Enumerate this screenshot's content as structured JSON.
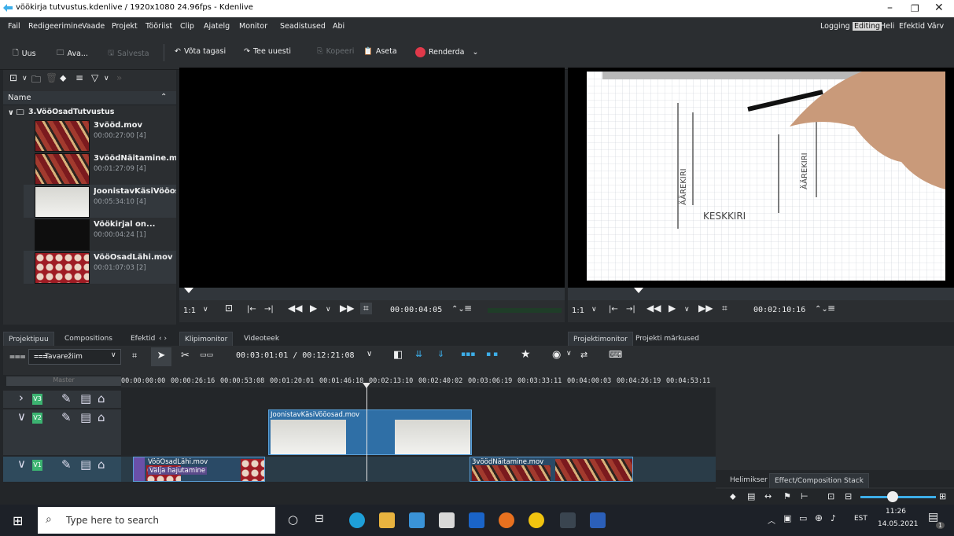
{
  "window": {
    "title": "vöökirja tutvustus.kdenlive / 1920x1080 24.96fps - Kdenlive"
  },
  "menu": [
    "Fail",
    "Redigeerimine",
    "Vaade",
    "Projekt",
    "Tööriist",
    "Clip",
    "Ajatelg",
    "Monitor",
    "Seadistused",
    "Abi"
  ],
  "workspaces": {
    "items": [
      "Logging",
      "Editing",
      "Heli",
      "Efektid",
      "Värv"
    ],
    "active": "Editing"
  },
  "toolbar": {
    "new": "Uus",
    "open": "Ava...",
    "save": "Salvesta",
    "undo": "Võta tagasi",
    "redo": "Tee uuesti",
    "copy": "Kopeeri",
    "paste": "Aseta",
    "render": "Renderda"
  },
  "bin": {
    "column_header": "Name",
    "folder": "3.VööOsadTutvustus",
    "clips": [
      {
        "name": "3vööd.mov",
        "duration": "00:00:27:00 [4]",
        "thumb": "stripe"
      },
      {
        "name": "3vöödNäitamine.mov",
        "duration": "00:01:27:09 [4]",
        "thumb": "stripe"
      },
      {
        "name": "JoonistavKäsiVööosad",
        "duration": "00:05:34:10 [4]",
        "thumb": "paper"
      },
      {
        "name": "Vöökirjal on...",
        "duration": "00:00:04:24 [1]",
        "thumb": "textcard"
      },
      {
        "name": "VööOsadLähi.mov",
        "duration": "00:01:07:03 [2]",
        "thumb": "redpat"
      }
    ],
    "tabs": [
      "Projektipuu",
      "Compositions",
      "Efektid"
    ]
  },
  "clip_monitor": {
    "zoom": "1:1",
    "timecode": "00:00:04:05",
    "tabs": [
      "Klipimonitor",
      "Videoteek"
    ]
  },
  "project_monitor": {
    "zoom": "1:1",
    "timecode": "00:02:10:16",
    "tabs": [
      "Projektimonitor",
      "Projekti märkused"
    ],
    "drawing_text": {
      "left": "ÄÄREKIRI",
      "middle": "KESKKIRI",
      "right": "ÄÄREKIRI"
    }
  },
  "timeline": {
    "mode": "Tavarežiim",
    "position": "00:03:01:01 / 00:12:21:08",
    "master": "Master",
    "ruler": [
      "00:00:00:00",
      "00:00:26:16",
      "00:00:53:08",
      "00:01:20:01",
      "00:01:46:18",
      "00:02:13:10",
      "00:02:40:02",
      "00:03:06:19",
      "00:03:33:11",
      "00:04:00:03",
      "00:04:26:19",
      "00:04:53:11"
    ],
    "tracks": [
      "V3",
      "V2",
      "V1"
    ],
    "clips": {
      "v2": "JoonistavKäsiVööosad.mov",
      "v1a": "VööOsadLähi.mov",
      "v1a_effect": "Välja hajutamine",
      "v1b": "3vöödNäitamine.mov"
    }
  },
  "right_tabs": [
    "Helimikser",
    "Effect/Composition Stack"
  ],
  "taskbar": {
    "search": "Type here to search",
    "lang": "EST",
    "time": "11:26",
    "date": "14.05.2021",
    "notif": "1"
  },
  "colors": {
    "accent": "#3daee9",
    "track_badge": "#3cb371",
    "render": "#e0394a"
  }
}
